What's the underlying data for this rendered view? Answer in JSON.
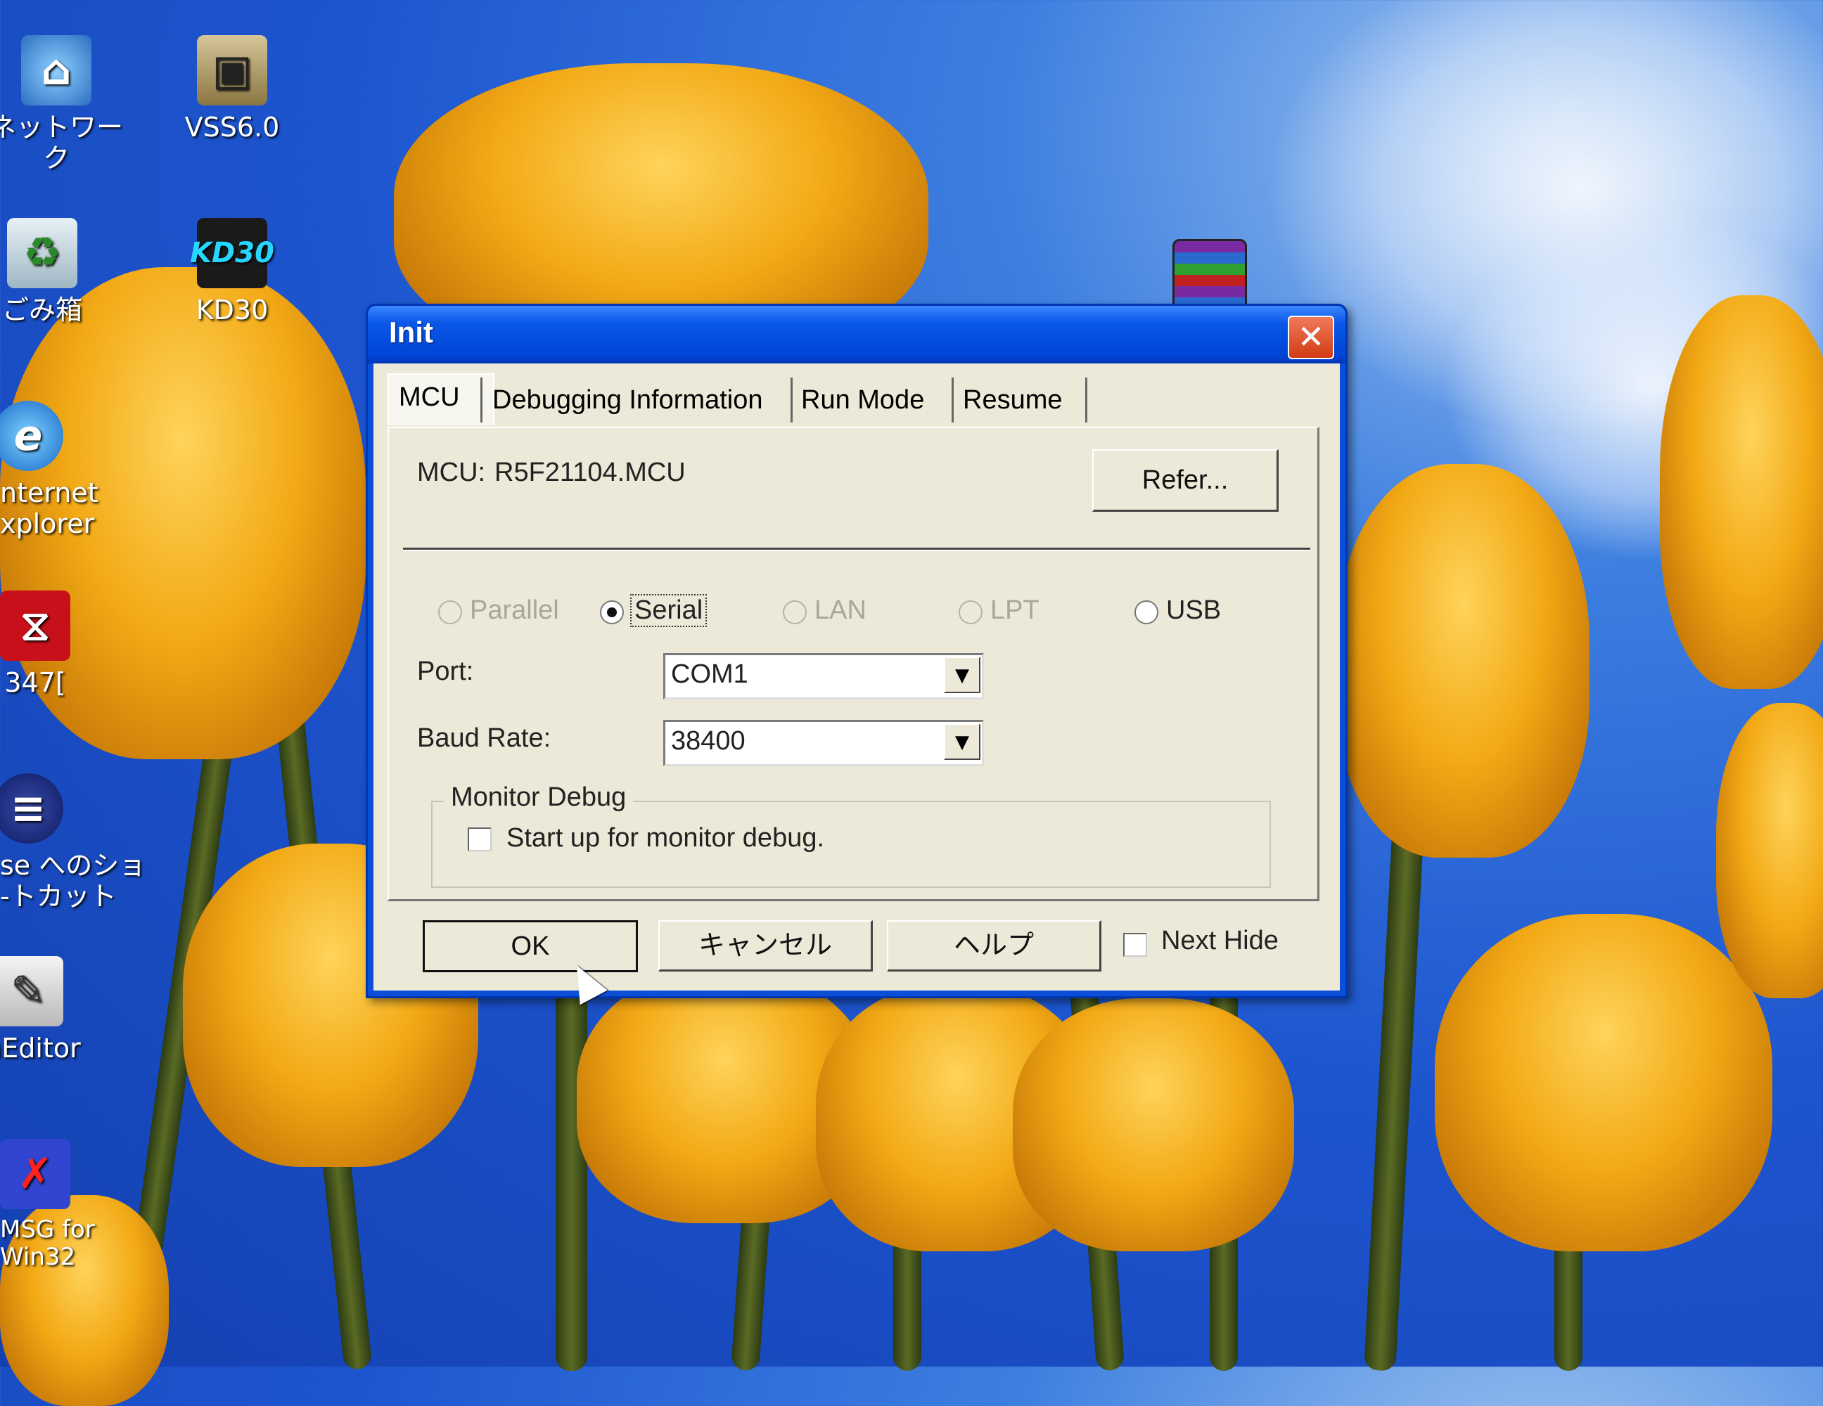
{
  "desktop": {
    "icons": [
      {
        "label": "ネットワーク",
        "icon": "network-icon"
      },
      {
        "label": "VSS6.0",
        "icon": "vss-icon"
      },
      {
        "label": "ごみ箱",
        "icon": "recycle-bin-icon"
      },
      {
        "label": "KD30",
        "icon": "kd30-icon",
        "glyph_text": "KD30"
      },
      {
        "label": "nternet\nxplorer",
        "icon": "internet-explorer-icon"
      },
      {
        "label": "347[",
        "icon": "pdf-icon"
      },
      {
        "label": "se へのショ\n-トカット",
        "icon": "shortcut-icon"
      },
      {
        "label": "mEditor",
        "icon": "editor-icon"
      },
      {
        "label": "MSG for\nWin32",
        "icon": "msg-icon"
      },
      {
        "label": "",
        "icon": "winrar-icon"
      }
    ]
  },
  "dialog": {
    "title": "Init",
    "close_glyph": "✕",
    "tabs": [
      {
        "label": "MCU",
        "active": true
      },
      {
        "label": "Debugging Information",
        "active": false
      },
      {
        "label": "Run Mode",
        "active": false
      },
      {
        "label": "Resume",
        "active": false
      }
    ],
    "mcu": {
      "label": "MCU:",
      "value": "R5F21104.MCU",
      "refer_button": "Refer..."
    },
    "connection": {
      "options": [
        {
          "label": "Parallel",
          "selected": false,
          "enabled": false
        },
        {
          "label": "Serial",
          "selected": true,
          "enabled": true
        },
        {
          "label": "LAN",
          "selected": false,
          "enabled": false
        },
        {
          "label": "LPT",
          "selected": false,
          "enabled": false
        },
        {
          "label": "USB",
          "selected": false,
          "enabled": true
        }
      ]
    },
    "port": {
      "label": "Port:",
      "value": "COM1"
    },
    "baud_rate": {
      "label": "Baud Rate:",
      "value": "38400"
    },
    "monitor_debug": {
      "group_title": "Monitor Debug",
      "checkbox_label": "Start up for monitor debug.",
      "checked": false
    },
    "buttons": {
      "ok": "OK",
      "cancel": "キャンセル",
      "help": "ヘルプ"
    },
    "next_hide": {
      "label": "Next Hide",
      "checked": false
    }
  },
  "colors": {
    "titlebar": "#0045d6",
    "dialog_bg": "#ece9d8",
    "close_button": "#d13b14"
  }
}
